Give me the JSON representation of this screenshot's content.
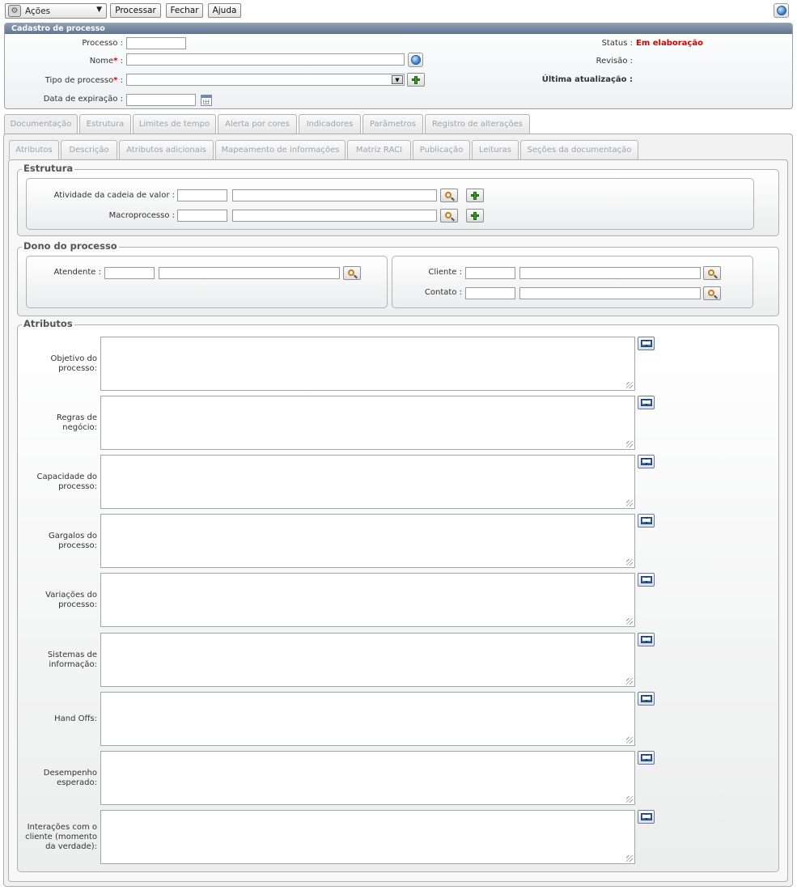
{
  "toolbar": {
    "actions_label": "Ações",
    "process_label": "Processar",
    "close_label": "Fechar",
    "help_label": "Ajuda"
  },
  "header": {
    "title": "Cadastro de processo",
    "processo_label": "Processo :",
    "nome_label": "Nome",
    "tipo_label": "Tipo de processo",
    "required_mark": "*",
    "colon": ":",
    "data_exp_label": "Data de expiração :",
    "status_label": "Status :",
    "status_value": "Em elaboração",
    "revisao_label": "Revisão :",
    "ultima_label": "Última atualização :",
    "values": {
      "processo": "",
      "nome": "",
      "tipo": "",
      "data_exp": ""
    }
  },
  "tabs": [
    "Documentação",
    "Estrutura",
    "Limites de tempo",
    "Alerta por cores",
    "Indicadores",
    "Parâmetros",
    "Registro de alterações"
  ],
  "subtabs": [
    "Atributos",
    "Descrição",
    "Atributos adicionais",
    "Mapeamento de informações",
    "Matriz RACI",
    "Publicação",
    "Leituras",
    "Seções da documentação"
  ],
  "estrutura": {
    "legend": "Estrutura",
    "atividade_label": "Atividade da cadeia de valor :",
    "macro_label": "Macroprocesso :"
  },
  "dono": {
    "legend": "Dono do processo",
    "atendente_label": "Atendente :",
    "cliente_label": "Cliente :",
    "contato_label": "Contato :"
  },
  "atributos": {
    "legend": "Atributos",
    "fields": [
      [
        "Objetivo do",
        "processo:"
      ],
      [
        "Regras de",
        "negócio:"
      ],
      [
        "Capacidade do",
        "processo:"
      ],
      [
        "Gargalos do",
        "processo:"
      ],
      [
        "Variações do",
        "processo:"
      ],
      [
        "Sistemas de",
        "informação:"
      ],
      [
        "Hand Offs:"
      ],
      [
        "Desempenho",
        "esperado:"
      ],
      [
        "Interações com o",
        "cliente (momento",
        "da verdade):"
      ]
    ]
  },
  "colors": {
    "header_bar": "#6f839c",
    "status_red": "#d40000",
    "required": "#e00000"
  },
  "icons": [
    "actions-icon",
    "globe-icon",
    "add-icon",
    "search-icon",
    "calendar-icon",
    "book-icon",
    "chevron-down-icon"
  ]
}
